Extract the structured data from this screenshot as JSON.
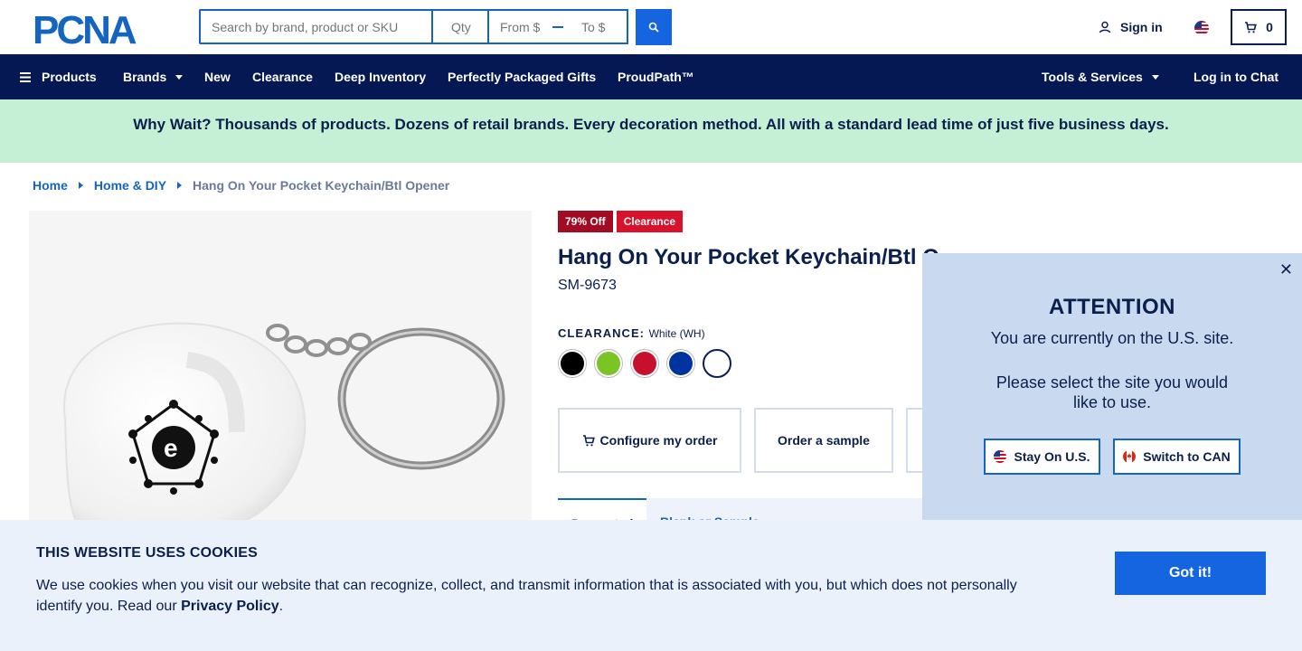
{
  "header": {
    "logo_text": "PCNA",
    "search_placeholder": "Search by brand, product or SKU",
    "qty_placeholder": "Qty",
    "price_from_placeholder": "From $",
    "price_to_placeholder": "To $",
    "sign_in_label": "Sign in",
    "cart_count": "0",
    "flag_icon": "us-flag-icon"
  },
  "nav": {
    "items": [
      {
        "label": "Products"
      },
      {
        "label": "Brands"
      },
      {
        "label": "New"
      },
      {
        "label": "Clearance"
      },
      {
        "label": "Deep Inventory"
      },
      {
        "label": "Perfectly Packaged Gifts"
      },
      {
        "label": "ProudPath™"
      }
    ],
    "tools_label": "Tools & Services",
    "chat_label": "Log in to Chat"
  },
  "promo": {
    "text": "Why Wait? Thousands of products. Dozens of retail brands. Every decoration method. All with a standard lead time of just five business days."
  },
  "breadcrumb": {
    "items": [
      "Home",
      "Home & DIY",
      "Hang On Your Pocket Keychain/Btl Opener"
    ]
  },
  "product": {
    "badges": [
      "79% Off",
      "Clearance"
    ],
    "title": "Hang On Your Pocket Keychain/Btl O",
    "sku": "SM-9673",
    "color_label": "CLEARANCE:",
    "color_value": "White (WH)",
    "swatches": [
      {
        "name": "Black",
        "color": "#000000"
      },
      {
        "name": "Lime Green",
        "color": "#7ac423"
      },
      {
        "name": "Red",
        "color": "#c8102e"
      },
      {
        "name": "Royal Blue",
        "color": "#0033a0"
      },
      {
        "name": "White",
        "color": "#ffffff"
      }
    ],
    "actions": [
      "Configure my order",
      "Order a sample"
    ],
    "tabs": [
      "Decorated",
      "Blank"
    ],
    "tab_partial_text": "Blank or Sample"
  },
  "attention": {
    "title": "ATTENTION",
    "line1": "You are currently on the U.S. site.",
    "line2": "Please select the site you would like to use.",
    "stay_label": "Stay On U.S.",
    "switch_label": "Switch to CAN"
  },
  "cookie": {
    "title": "THIS WEBSITE USES COOKIES",
    "text_before": "We use cookies when you visit our website that can recognize, collect, and transmit information that is associated with you, but which does not personally identify you. Read our ",
    "link": "Privacy Policy",
    "text_after": ".",
    "button": "Got it!"
  },
  "colors": {
    "navy": "#061854",
    "brand_blue": "#1565c0",
    "promo_green": "#c6f0d6",
    "clearance_red": "#d9122c"
  }
}
